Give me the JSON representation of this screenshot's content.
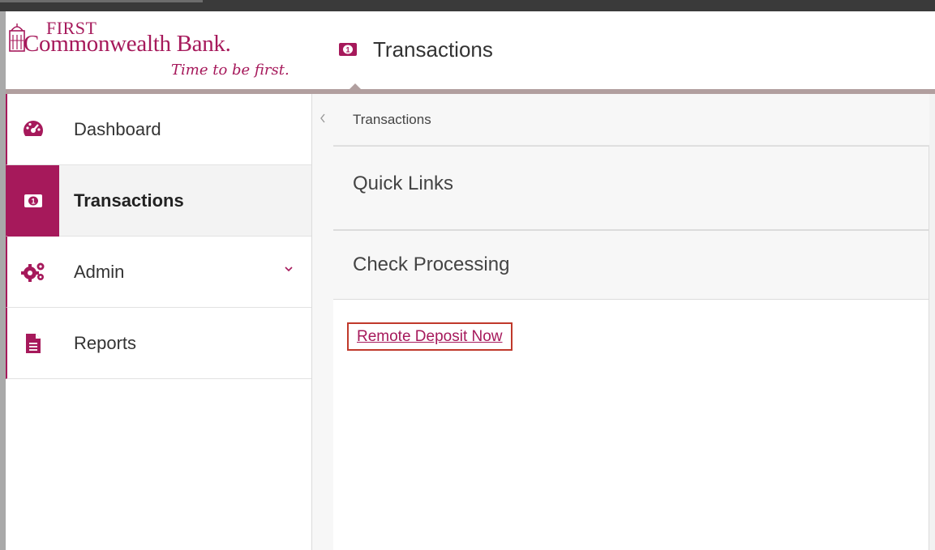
{
  "logo": {
    "first": "FIRST",
    "name": "Commonwealth Bank.",
    "tagline": "Time to be first."
  },
  "header": {
    "icon": "money-icon",
    "title": "Transactions"
  },
  "sidebar": {
    "items": [
      {
        "label": "Dashboard",
        "icon": "dashboard-gauge-icon",
        "active": false
      },
      {
        "label": "Transactions",
        "icon": "money-icon",
        "active": true
      },
      {
        "label": "Admin",
        "icon": "gears-icon",
        "active": false,
        "expandable": true
      },
      {
        "label": "Reports",
        "icon": "document-icon",
        "active": false
      }
    ]
  },
  "breadcrumb": {
    "current": "Transactions"
  },
  "main": {
    "quick_links_title": "Quick Links",
    "check_processing_title": "Check Processing",
    "links": [
      {
        "label": "Remote Deposit Now"
      }
    ]
  },
  "colors": {
    "brand": "#a6195b",
    "highlight_box": "#c0392b",
    "header_bar": "#b19f9f"
  }
}
